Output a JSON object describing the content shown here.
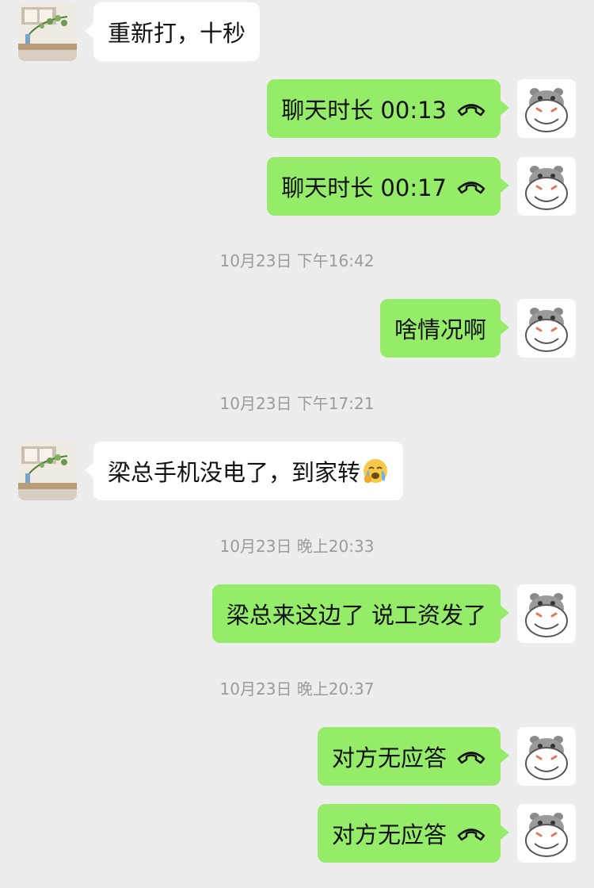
{
  "messages": [
    {
      "side": "other",
      "text": "重新打，十秒"
    },
    {
      "side": "self",
      "text": "聊天时长 00:13",
      "icon": "phone-hangup-icon"
    },
    {
      "side": "self",
      "text": "聊天时长 00:17",
      "icon": "phone-hangup-icon"
    },
    {
      "type": "timestamp",
      "text": "10月23日 下午16:42"
    },
    {
      "side": "self",
      "text": "啥情况啊"
    },
    {
      "type": "timestamp",
      "text": "10月23日 下午17:21"
    },
    {
      "side": "other",
      "text": "梁总手机没电了，到家转",
      "emoji": "crying-face-emoji"
    },
    {
      "type": "timestamp",
      "text": "10月23日 晚上20:33"
    },
    {
      "side": "self",
      "text": "梁总来这边了 说工资发了"
    },
    {
      "type": "timestamp",
      "text": "10月23日 晚上20:37"
    },
    {
      "side": "self",
      "text": "对方无应答",
      "icon": "phone-hangup-icon"
    },
    {
      "side": "self",
      "text": "对方无应答",
      "icon": "phone-hangup-icon"
    }
  ],
  "colors": {
    "self_bubble": "#95ec69",
    "other_bubble": "#ffffff",
    "background": "#ededed",
    "timestamp": "#9b9b9b"
  }
}
